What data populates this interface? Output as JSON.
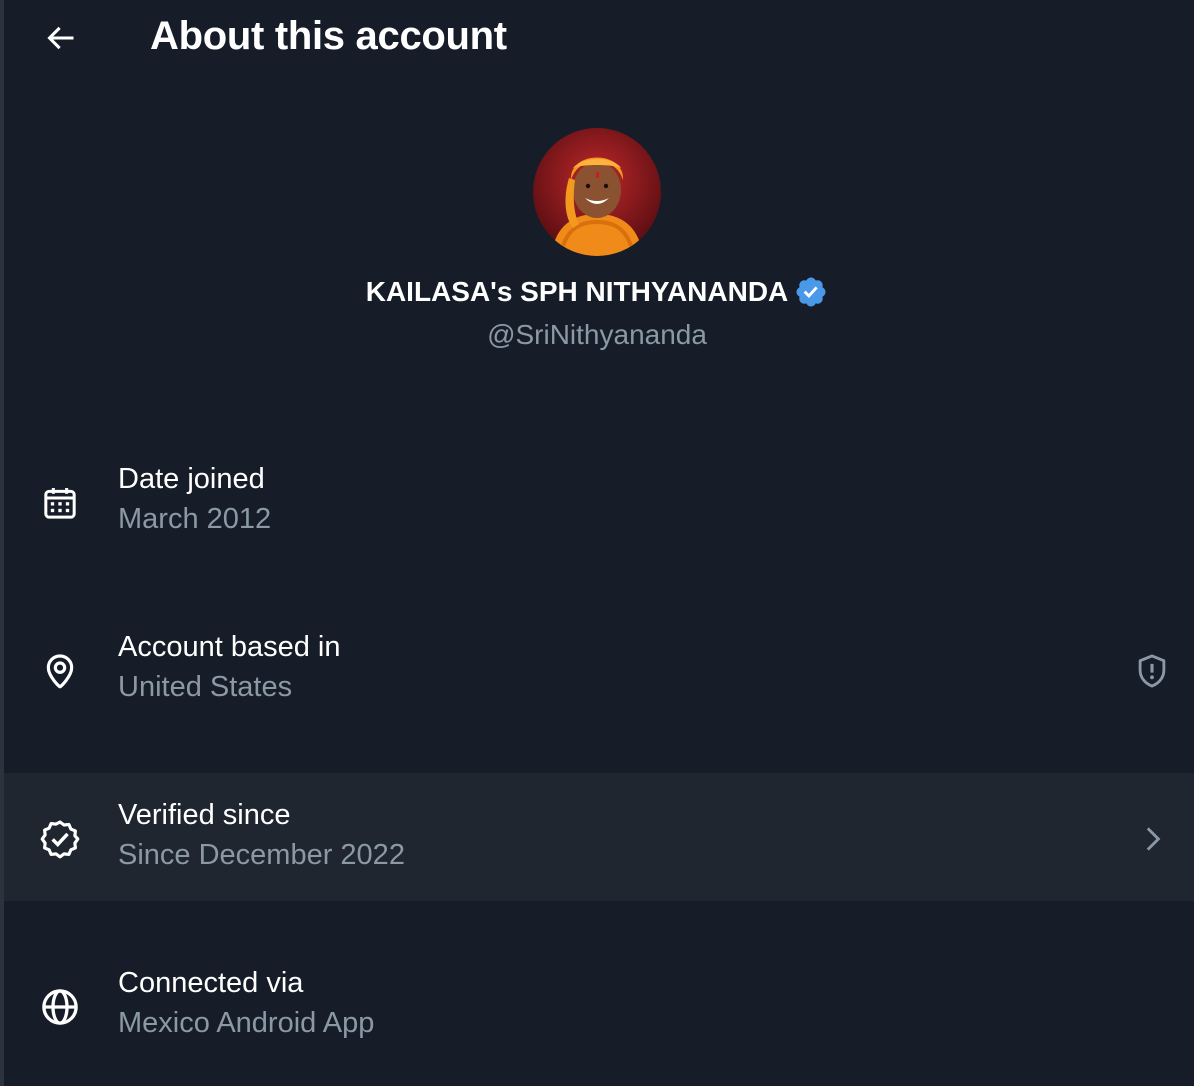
{
  "header": {
    "title": "About this account",
    "back_icon": "back-arrow-icon"
  },
  "profile": {
    "display_name": "KAILASA's SPH NITHYANANDA",
    "handle": "@SriNithyananda",
    "verified": true,
    "badge_color": "#4a99e9"
  },
  "rows": [
    {
      "title": "Date joined",
      "value": "March 2012",
      "icon": "calendar-icon"
    },
    {
      "title": "Account based in",
      "value": "United States",
      "icon": "location-pin-icon",
      "trailing_icon": "shield-alert-icon"
    },
    {
      "title": "Verified since",
      "value": "Since December 2022",
      "icon": "verified-check-icon",
      "trailing_icon": "chevron-right-icon"
    },
    {
      "title": "Connected via",
      "value": "Mexico Android App",
      "icon": "globe-icon"
    }
  ],
  "colors": {
    "background": "#161d28",
    "highlight_row": "#1f2630",
    "primary_text": "#ffffff",
    "secondary_text": "#8b98a5"
  }
}
